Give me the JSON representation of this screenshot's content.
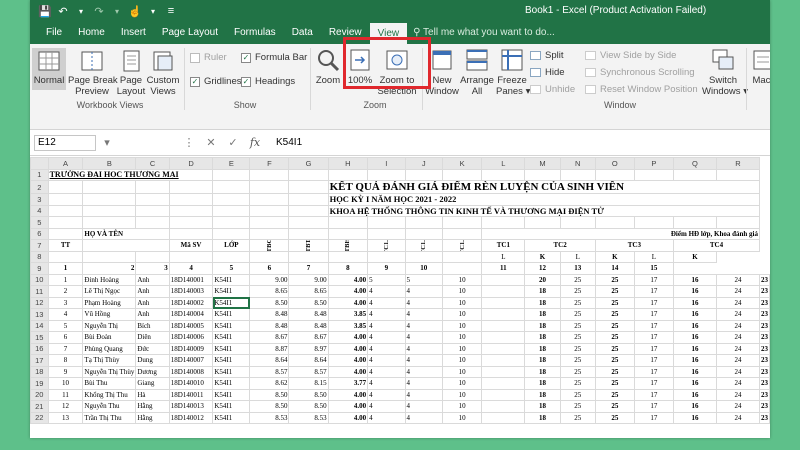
{
  "titlebar": {
    "save_icon": "save-icon",
    "undo_icon": "undo-icon",
    "redo_icon": "redo-icon",
    "touch_icon": "touch-mode-icon",
    "customize_icon": "customize-qat-icon",
    "title": "Book1 - Excel (Product Activation Failed)"
  },
  "tabs": [
    "File",
    "Home",
    "Insert",
    "Page Layout",
    "Formulas",
    "Data",
    "Review",
    "View"
  ],
  "active_tab": "View",
  "tell_me": "Tell me what you want to do...",
  "ribbon": {
    "workbook_views": {
      "label": "Workbook Views",
      "normal": "Normal",
      "page_break_1": "Page Break",
      "page_break_2": "Preview",
      "page_layout_1": "Page",
      "page_layout_2": "Layout",
      "custom_1": "Custom",
      "custom_2": "Views"
    },
    "show": {
      "label": "Show",
      "ruler": "Ruler",
      "formula_bar": "Formula Bar",
      "gridlines": "Gridlines",
      "headings": "Headings"
    },
    "zoom": {
      "label": "Zoom",
      "zoom": "Zoom",
      "hundred": "100%",
      "zoom_sel_1": "Zoom to",
      "zoom_sel_2": "Selection"
    },
    "window": {
      "label": "Window",
      "new_1": "New",
      "new_2": "Window",
      "arrange_1": "Arrange",
      "arrange_2": "All",
      "freeze_1": "Freeze",
      "freeze_2": "Panes",
      "split": "Split",
      "hide": "Hide",
      "unhide": "Unhide",
      "side_by_side": "View Side by Side",
      "sync_scroll": "Synchronous Scrolling",
      "reset_pos": "Reset Window Position",
      "switch_1": "Switch",
      "switch_2": "Windows",
      "macros": "Macr"
    }
  },
  "formula": {
    "name_box": "E12",
    "fx": "fx",
    "value": "K54I1"
  },
  "columns": [
    "A",
    "B",
    "C",
    "D",
    "E",
    "F",
    "G",
    "H",
    "I",
    "J",
    "K",
    "L",
    "M",
    "N",
    "O",
    "P",
    "Q",
    "R"
  ],
  "sheet": {
    "school": "TRƯỜNG ĐẠI HỌC THƯƠNG MẠI",
    "title": "KẾT QUẢ ĐÁNH GIÁ ĐIỂM RÈN LUYỆN CỦA SINH VIÊN",
    "semester": "HỌC KỲ I NĂM HỌC 2021 - 2022",
    "faculty": "KHOA HỆ THỐNG THÔNG TIN KINH TẾ VÀ THƯƠNG MẠI ĐIỆN TỬ",
    "h_tt": "TT",
    "h_name": "HỌ VÀ TÊN",
    "h_msv": "Mã SV",
    "h_lop": "LỚP",
    "h_dtbcc": "ĐTBCC",
    "h_dtbth": "ĐTBTH",
    "h_dtbht": "ĐTBHT",
    "h_tc11": "TC1.1",
    "h_tc12": "TC1.2",
    "h_tc13": "TC1.3",
    "h_diem_hd": "Điểm HĐ lớp, Khoa đánh giá",
    "h_tc1": "TC1",
    "h_tc2": "TC2",
    "h_tc3": "TC3",
    "h_tc4": "TC4",
    "h_l": "L",
    "h_k": "K",
    "idx": [
      "1",
      "2",
      "3",
      "4",
      "5",
      "6",
      "7",
      "8",
      "9",
      "10",
      "11",
      "12",
      "13",
      "14",
      "15"
    ],
    "rows": [
      {
        "tt": "1",
        "ho": "Đinh Hoàng",
        "ten": "Anh",
        "msv": "18D140001",
        "lop": "K54I1",
        "cc": "9.00",
        "th": "9.00",
        "ht": "4.00",
        "a": "5",
        "b": "5",
        "c": "10",
        "tc1": "20",
        "l2": "25",
        "k2": "25",
        "l3": "17",
        "k3": "16",
        "l4": "24",
        "k4": "23"
      },
      {
        "tt": "2",
        "ho": "Lê Thị Ngọc",
        "ten": "Anh",
        "msv": "18D140003",
        "lop": "K54I1",
        "cc": "8.65",
        "th": "8.65",
        "ht": "4.00",
        "a": "4",
        "b": "4",
        "c": "10",
        "tc1": "18",
        "l2": "25",
        "k2": "25",
        "l3": "17",
        "k3": "16",
        "l4": "24",
        "k4": "23"
      },
      {
        "tt": "3",
        "ho": "Phạm Hoàng",
        "ten": "Anh",
        "msv": "18D140002",
        "lop": "K54I1",
        "cc": "8.50",
        "th": "8.50",
        "ht": "4.00",
        "a": "4",
        "b": "4",
        "c": "10",
        "tc1": "18",
        "l2": "25",
        "k2": "25",
        "l3": "17",
        "k3": "16",
        "l4": "24",
        "k4": "23"
      },
      {
        "tt": "4",
        "ho": "Vũ Hồng",
        "ten": "Anh",
        "msv": "18D140004",
        "lop": "K54I1",
        "cc": "8.48",
        "th": "8.48",
        "ht": "3.85",
        "a": "4",
        "b": "4",
        "c": "10",
        "tc1": "18",
        "l2": "25",
        "k2": "25",
        "l3": "17",
        "k3": "16",
        "l4": "24",
        "k4": "23"
      },
      {
        "tt": "5",
        "ho": "Nguyễn Thị",
        "ten": "Bích",
        "msv": "18D140005",
        "lop": "K54I1",
        "cc": "8.48",
        "th": "8.48",
        "ht": "3.85",
        "a": "4",
        "b": "4",
        "c": "10",
        "tc1": "18",
        "l2": "25",
        "k2": "25",
        "l3": "17",
        "k3": "16",
        "l4": "24",
        "k4": "23"
      },
      {
        "tt": "6",
        "ho": "Bùi Đoàn",
        "ten": "Diên",
        "msv": "18D140006",
        "lop": "K54I1",
        "cc": "8.67",
        "th": "8.67",
        "ht": "4.00",
        "a": "4",
        "b": "4",
        "c": "10",
        "tc1": "18",
        "l2": "25",
        "k2": "25",
        "l3": "17",
        "k3": "16",
        "l4": "24",
        "k4": "23"
      },
      {
        "tt": "7",
        "ho": "Phùng Quang",
        "ten": "Đức",
        "msv": "18D140009",
        "lop": "K54I1",
        "cc": "8.87",
        "th": "8.97",
        "ht": "4.00",
        "a": "4",
        "b": "4",
        "c": "10",
        "tc1": "18",
        "l2": "25",
        "k2": "25",
        "l3": "17",
        "k3": "16",
        "l4": "24",
        "k4": "23"
      },
      {
        "tt": "8",
        "ho": "Tạ Thị Thùy",
        "ten": "Dung",
        "msv": "18D140007",
        "lop": "K54I1",
        "cc": "8.64",
        "th": "8.64",
        "ht": "4.00",
        "a": "4",
        "b": "4",
        "c": "10",
        "tc1": "18",
        "l2": "25",
        "k2": "25",
        "l3": "17",
        "k3": "16",
        "l4": "24",
        "k4": "23"
      },
      {
        "tt": "9",
        "ho": "Nguyễn Thị Thùy",
        "ten": "Dương",
        "msv": "18D140008",
        "lop": "K54I1",
        "cc": "8.57",
        "th": "8.57",
        "ht": "4.00",
        "a": "4",
        "b": "4",
        "c": "10",
        "tc1": "18",
        "l2": "25",
        "k2": "25",
        "l3": "17",
        "k3": "16",
        "l4": "24",
        "k4": "23"
      },
      {
        "tt": "10",
        "ho": "Bùi Thu",
        "ten": "Giang",
        "msv": "18D140010",
        "lop": "K54I1",
        "cc": "8.62",
        "th": "8.15",
        "ht": "3.77",
        "a": "4",
        "b": "4",
        "c": "10",
        "tc1": "18",
        "l2": "25",
        "k2": "25",
        "l3": "17",
        "k3": "16",
        "l4": "24",
        "k4": "23"
      },
      {
        "tt": "11",
        "ho": "Khổng Thị Thu",
        "ten": "Hà",
        "msv": "18D140011",
        "lop": "K54I1",
        "cc": "8.50",
        "th": "8.50",
        "ht": "4.00",
        "a": "4",
        "b": "4",
        "c": "10",
        "tc1": "18",
        "l2": "25",
        "k2": "25",
        "l3": "17",
        "k3": "16",
        "l4": "24",
        "k4": "23"
      },
      {
        "tt": "12",
        "ho": "Nguyễn Thu",
        "ten": "Hằng",
        "msv": "18D140013",
        "lop": "K54I1",
        "cc": "8.50",
        "th": "8.50",
        "ht": "4.00",
        "a": "4",
        "b": "4",
        "c": "10",
        "tc1": "18",
        "l2": "25",
        "k2": "25",
        "l3": "17",
        "k3": "16",
        "l4": "24",
        "k4": "23"
      },
      {
        "tt": "13",
        "ho": "Trần Thị Thu",
        "ten": "Hằng",
        "msv": "18D140012",
        "lop": "K54I1",
        "cc": "8.53",
        "th": "8.53",
        "ht": "4.00",
        "a": "4",
        "b": "4",
        "c": "10",
        "tc1": "18",
        "l2": "25",
        "k2": "25",
        "l3": "17",
        "k3": "16",
        "l4": "24",
        "k4": "23"
      }
    ]
  },
  "colors": {
    "excel_green": "#217346",
    "highlight_red": "#e0282d"
  }
}
